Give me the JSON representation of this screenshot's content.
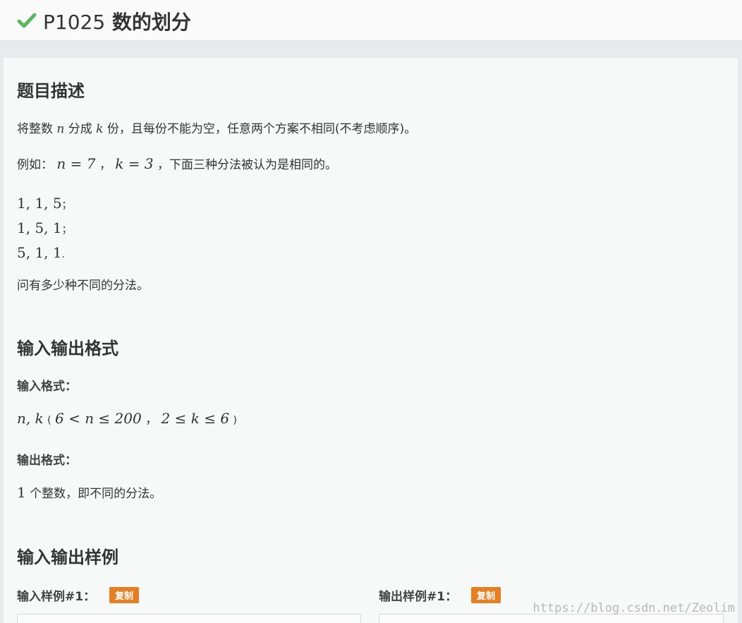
{
  "header": {
    "problem_id": "P1025",
    "problem_name": "数的划分",
    "status_icon": "check-icon",
    "status_color": "#5cb85c"
  },
  "description": {
    "heading": "题目描述",
    "p1": {
      "a": "将整数",
      "n": "n",
      "b": "分成",
      "k": "k",
      "c": "份，且每份不能为空，任意两个方案不相同(不考虑顺序)。"
    },
    "p2": {
      "a": "例如：",
      "eq1": "n = 7",
      "sep": "，",
      "eq2": "k = 3",
      "b": "，下面三种分法被认为是相同的。"
    },
    "list": [
      {
        "nums": "1, 1, 5",
        "end": "；"
      },
      {
        "nums": "1, 5, 1",
        "end": "；"
      },
      {
        "nums": "5, 1, 1",
        "end": "."
      }
    ],
    "question": "问有多少种不同的分法。"
  },
  "io_format": {
    "heading": "输入输出格式",
    "input_label": "输入格式：",
    "input": {
      "vars": "n, k",
      "open": "(",
      "c1": "6 < n ≤ 200",
      "sep": "，",
      "c2": "2 ≤ k ≤ 6",
      "close": ")"
    },
    "output_label": "输出格式：",
    "output": {
      "num": "1",
      "text": "个整数，即不同的分法。"
    }
  },
  "samples": {
    "heading": "输入输出样例",
    "input_label": "输入样例#1：",
    "output_label": "输出样例#1：",
    "copy_label": "复制",
    "copy_color": "#e67e22"
  },
  "watermark": "https://blog.csdn.net/Zeolim"
}
